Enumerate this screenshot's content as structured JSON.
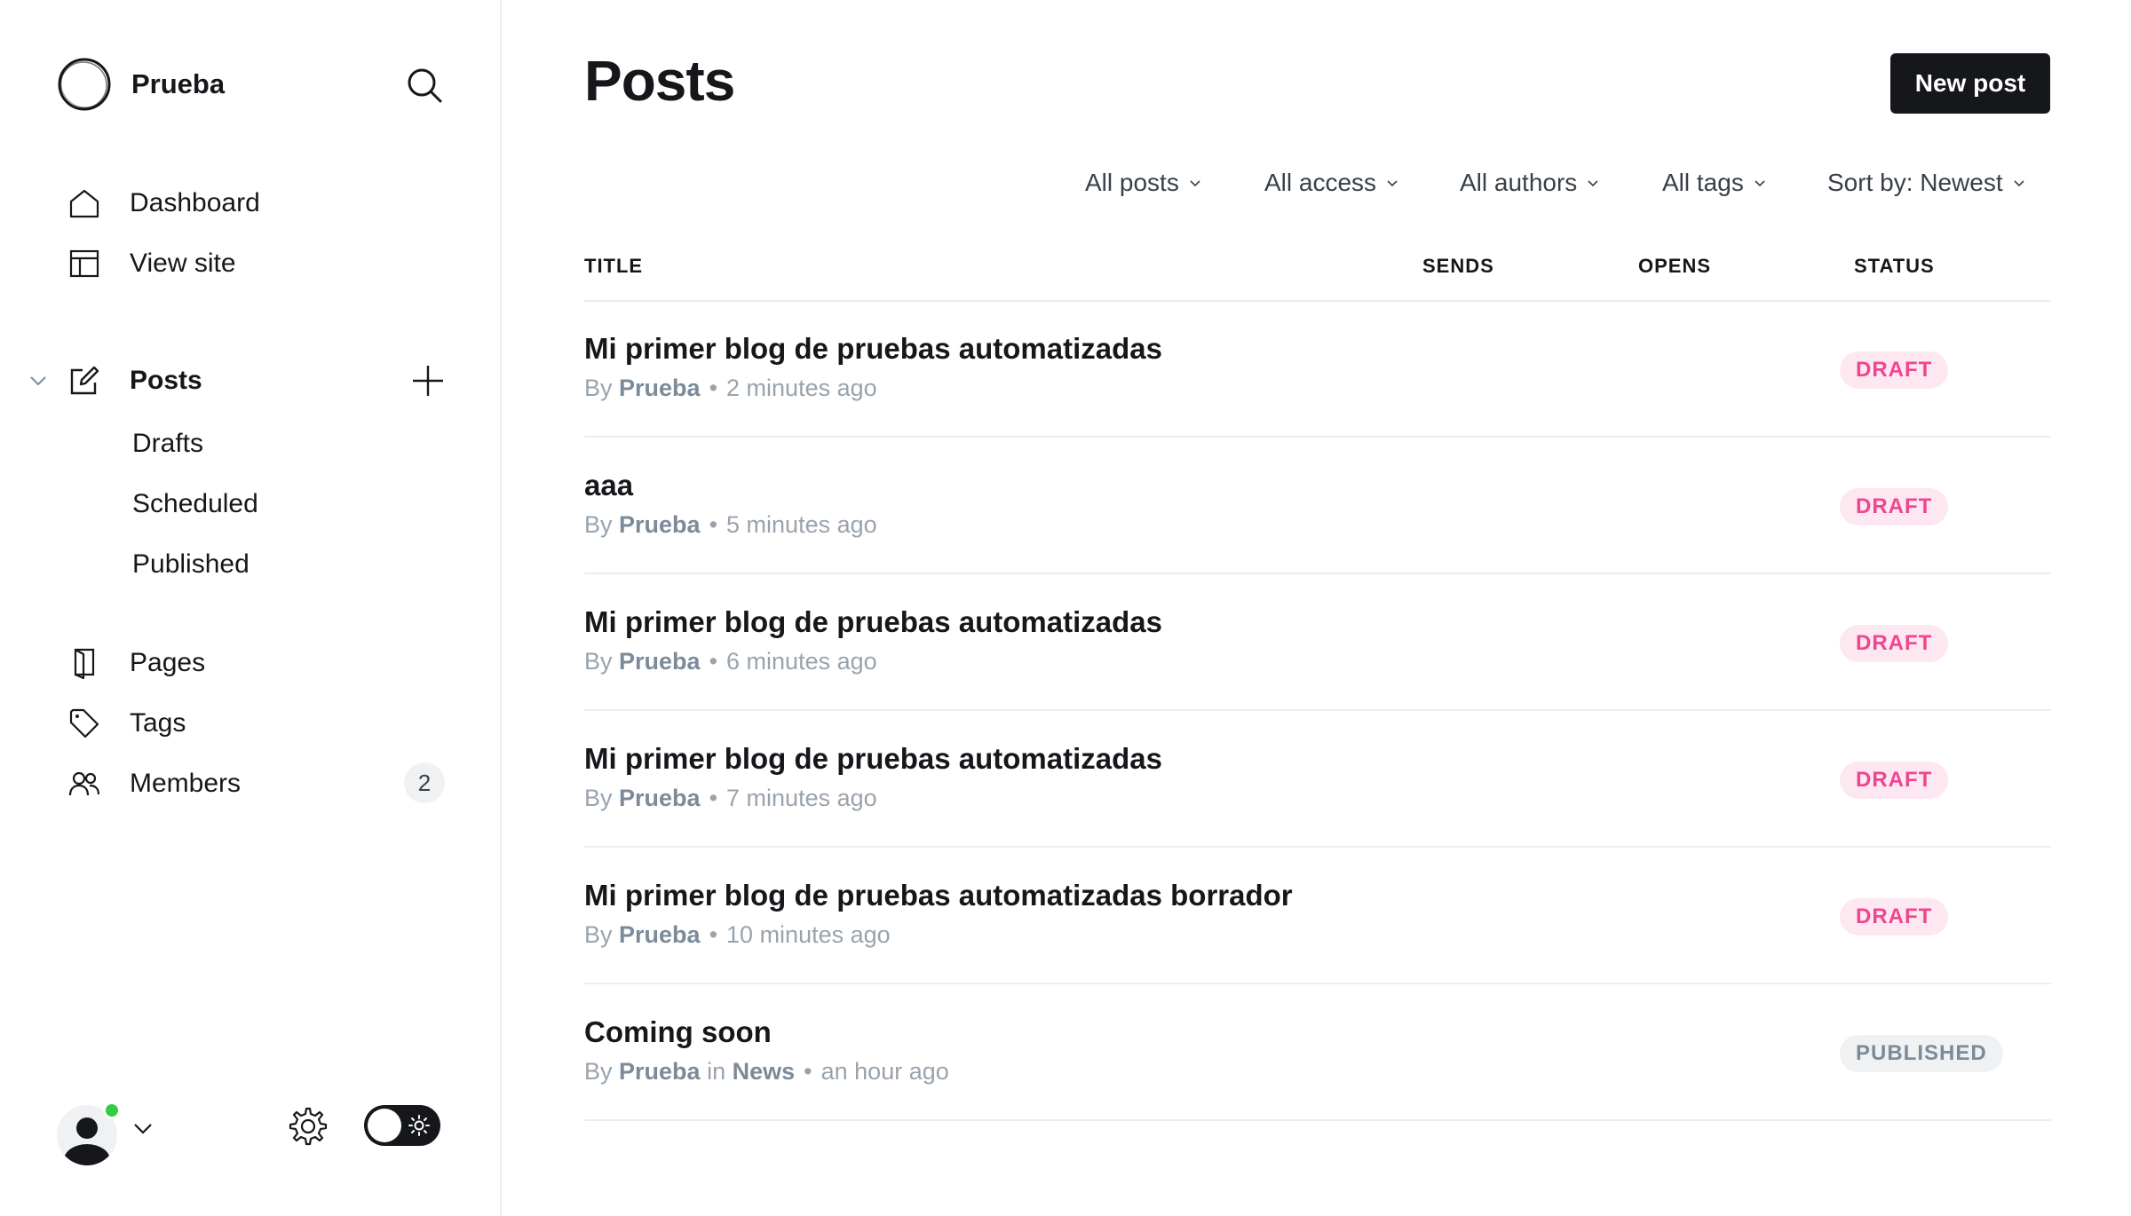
{
  "site": {
    "name": "Prueba"
  },
  "sidebar": {
    "nav": [
      {
        "label": "Dashboard",
        "icon": "home-icon"
      },
      {
        "label": "View site",
        "icon": "layout-icon"
      }
    ],
    "posts": {
      "label": "Posts",
      "subitems": [
        "Drafts",
        "Scheduled",
        "Published"
      ]
    },
    "secondary": [
      {
        "label": "Pages",
        "icon": "pages-icon"
      },
      {
        "label": "Tags",
        "icon": "tag-icon"
      },
      {
        "label": "Members",
        "icon": "members-icon",
        "count": "2"
      }
    ]
  },
  "main": {
    "title": "Posts",
    "new_post_label": "New post",
    "filters": [
      "All posts",
      "All access",
      "All authors",
      "All tags",
      "Sort by: Newest"
    ],
    "columns": {
      "title": "TITLE",
      "sends": "SENDS",
      "opens": "OPENS",
      "status": "STATUS"
    },
    "posts": [
      {
        "title": "Mi primer blog de pruebas automatizadas",
        "by": "By",
        "author": "Prueba",
        "in": "",
        "tag": "",
        "time": "2 minutes ago",
        "status": "DRAFT"
      },
      {
        "title": "aaa",
        "by": "By",
        "author": "Prueba",
        "in": "",
        "tag": "",
        "time": "5 minutes ago",
        "status": "DRAFT"
      },
      {
        "title": "Mi primer blog de pruebas automatizadas",
        "by": "By",
        "author": "Prueba",
        "in": "",
        "tag": "",
        "time": "6 minutes ago",
        "status": "DRAFT"
      },
      {
        "title": "Mi primer blog de pruebas automatizadas",
        "by": "By",
        "author": "Prueba",
        "in": "",
        "tag": "",
        "time": "7 minutes ago",
        "status": "DRAFT"
      },
      {
        "title": "Mi primer blog de pruebas automatizadas borrador",
        "by": "By",
        "author": "Prueba",
        "in": "",
        "tag": "",
        "time": "10 minutes ago",
        "status": "DRAFT"
      },
      {
        "title": "Coming soon",
        "by": "By",
        "author": "Prueba",
        "in": "in",
        "tag": "News",
        "time": "an hour ago",
        "status": "PUBLISHED"
      }
    ]
  },
  "colors": {
    "draft": "#f0458f",
    "draft_bg": "#fde8f1",
    "published": "#7c8b9a",
    "online": "#30cf43",
    "primary": "#15171a"
  }
}
